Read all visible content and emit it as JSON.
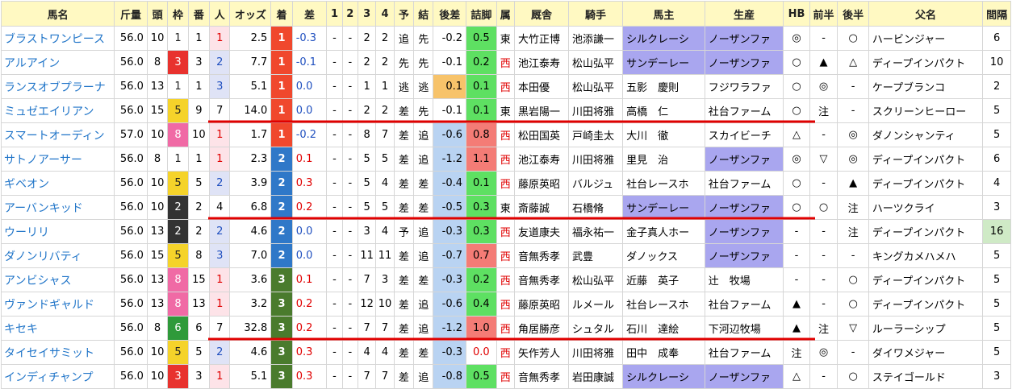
{
  "header": [
    "馬名",
    "斤量",
    "頭",
    "枠",
    "番",
    "人",
    "オッズ",
    "着",
    "差",
    "1",
    "2",
    "3",
    "4",
    "予",
    "結",
    "後差",
    "詰脚",
    "属",
    "厩舎",
    "騎手",
    "馬主",
    "生産",
    "HB",
    "前半",
    "後半",
    "父名",
    "間隔"
  ],
  "rows": [
    [
      "ブラストワンピース",
      "56.0",
      "10",
      "1",
      "1",
      "1",
      "2.5",
      "1",
      "-0.3",
      "-",
      "-",
      "2",
      "2",
      "追",
      "先",
      "-0.2",
      "0.5",
      "東",
      "大竹正博",
      "池添謙一",
      "シルクレーシ",
      "ノーザンファ",
      "◎",
      "-",
      "○",
      "ハービンジャー",
      "6"
    ],
    [
      "アルアイン",
      "56.0",
      "8",
      "3",
      "3",
      "2",
      "7.7",
      "1",
      "-0.1",
      "-",
      "-",
      "2",
      "2",
      "先",
      "先",
      "-0.1",
      "0.2",
      "西",
      "池江泰寿",
      "松山弘平",
      "サンデーレー",
      "ノーザンファ",
      "○",
      "▲",
      "△",
      "ディープインパクト",
      "10"
    ],
    [
      "ランスオブプラーナ",
      "56.0",
      "13",
      "1",
      "1",
      "3",
      "5.1",
      "1",
      "0.0",
      "-",
      "-",
      "1",
      "1",
      "逃",
      "逃",
      "0.1",
      "0.1",
      "西",
      "本田優",
      "松山弘平",
      "五影　慶則",
      "フジワラファ",
      "○",
      "◎",
      "-",
      "ケープブランコ",
      "2"
    ],
    [
      "ミュゼエイリアン",
      "56.0",
      "15",
      "5",
      "9",
      "7",
      "14.0",
      "1",
      "0.0",
      "-",
      "-",
      "2",
      "2",
      "差",
      "先",
      "-0.1",
      "0.1",
      "東",
      "黒岩陽一",
      "川田将雅",
      "高橋　仁",
      "社台ファーム",
      "○",
      "注",
      "-",
      "スクリーンヒーロー",
      "5"
    ],
    [
      "スマートオーディン",
      "57.0",
      "10",
      "8",
      "10",
      "1",
      "1.7",
      "1",
      "-0.2",
      "-",
      "-",
      "8",
      "7",
      "差",
      "追",
      "-0.6",
      "0.8",
      "西",
      "松田国英",
      "戸崎圭太",
      "大川　徹",
      "スカイビーチ",
      "△",
      "-",
      "◎",
      "ダノンシャンティ",
      "5"
    ],
    [
      "サトノアーサー",
      "56.0",
      "8",
      "1",
      "1",
      "1",
      "2.3",
      "2",
      "0.1",
      "-",
      "-",
      "5",
      "5",
      "差",
      "追",
      "-1.2",
      "1.1",
      "西",
      "池江泰寿",
      "川田将雅",
      "里見　治",
      "ノーザンファ",
      "◎",
      "▽",
      "◎",
      "ディープインパクト",
      "6"
    ],
    [
      "ギベオン",
      "56.0",
      "10",
      "5",
      "5",
      "2",
      "3.9",
      "2",
      "0.3",
      "-",
      "-",
      "5",
      "4",
      "差",
      "差",
      "-0.4",
      "0.1",
      "西",
      "藤原英昭",
      "バルジュ",
      "社台レースホ",
      "社台ファーム",
      "○",
      "-",
      "▲",
      "ディープインパクト",
      "4"
    ],
    [
      "アーバンキッド",
      "56.0",
      "10",
      "2",
      "2",
      "4",
      "6.8",
      "2",
      "0.2",
      "-",
      "-",
      "5",
      "5",
      "差",
      "差",
      "-0.5",
      "0.3",
      "東",
      "斎藤誠",
      "石橋脩",
      "サンデーレー",
      "ノーザンファ",
      "○",
      "○",
      "注",
      "ハーツクライ",
      "3"
    ],
    [
      "ウーリリ",
      "56.0",
      "13",
      "2",
      "2",
      "2",
      "4.6",
      "2",
      "0.0",
      "-",
      "-",
      "3",
      "4",
      "予",
      "追",
      "-0.3",
      "0.3",
      "西",
      "友道康夫",
      "福永祐一",
      "金子真人ホー",
      "ノーザンファ",
      "-",
      "-",
      "注",
      "ディープインパクト",
      "16"
    ],
    [
      "ダノンリバティ",
      "56.0",
      "15",
      "5",
      "8",
      "3",
      "7.0",
      "2",
      "0.0",
      "-",
      "-",
      "11",
      "11",
      "差",
      "追",
      "-0.7",
      "0.7",
      "西",
      "音無秀孝",
      "武豊",
      "ダノックス",
      "ノーザンファ",
      "-",
      "-",
      "-",
      "キングカメハメハ",
      "5"
    ],
    [
      "アンビシャス",
      "56.0",
      "13",
      "8",
      "15",
      "1",
      "3.6",
      "3",
      "0.1",
      "-",
      "-",
      "7",
      "3",
      "差",
      "差",
      "-0.3",
      "0.2",
      "西",
      "音無秀孝",
      "松山弘平",
      "近藤　英子",
      "辻　牧場",
      "-",
      "-",
      "○",
      "ディープインパクト",
      "5"
    ],
    [
      "ヴァンドギャルド",
      "56.0",
      "13",
      "8",
      "13",
      "1",
      "3.2",
      "3",
      "0.2",
      "-",
      "-",
      "12",
      "10",
      "差",
      "追",
      "-0.6",
      "0.4",
      "西",
      "藤原英昭",
      "ルメール",
      "社台レースホ",
      "社台ファーム",
      "▲",
      "-",
      "○",
      "ディープインパクト",
      "5"
    ],
    [
      "キセキ",
      "56.0",
      "8",
      "6",
      "6",
      "7",
      "32.8",
      "3",
      "0.2",
      "-",
      "-",
      "7",
      "7",
      "差",
      "追",
      "-1.2",
      "1.0",
      "西",
      "角居勝彦",
      "シュタル",
      "石川　達絵",
      "下河辺牧場",
      "▲",
      "注",
      "▽",
      "ルーラーシップ",
      "5"
    ],
    [
      "タイセイサミット",
      "56.0",
      "10",
      "5",
      "5",
      "2",
      "4.6",
      "3",
      "0.3",
      "-",
      "-",
      "4",
      "4",
      "差",
      "差",
      "-0.3",
      "0.0",
      "西",
      "矢作芳人",
      "川田将雅",
      "田中　成奉",
      "社台ファーム",
      "注",
      "◎",
      "-",
      "ダイワメジャー",
      "5"
    ],
    [
      "インディチャンプ",
      "56.0",
      "10",
      "3",
      "3",
      "1",
      "5.1",
      "3",
      "0.3",
      "-",
      "-",
      "7",
      "7",
      "差",
      "追",
      "-0.8",
      "0.5",
      "西",
      "音無秀孝",
      "岩田康誠",
      "シルクレーシ",
      "ノーザンファ",
      "△",
      "-",
      "○",
      "ステイゴールド",
      "3"
    ]
  ],
  "colors": {
    "header_bg": "#fff9c2",
    "name_link": "#1f74c8",
    "underline": "#e00000",
    "rank1": "#f0482d",
    "rank2": "#2f78c8",
    "rank3": "#4a7b2d"
  }
}
